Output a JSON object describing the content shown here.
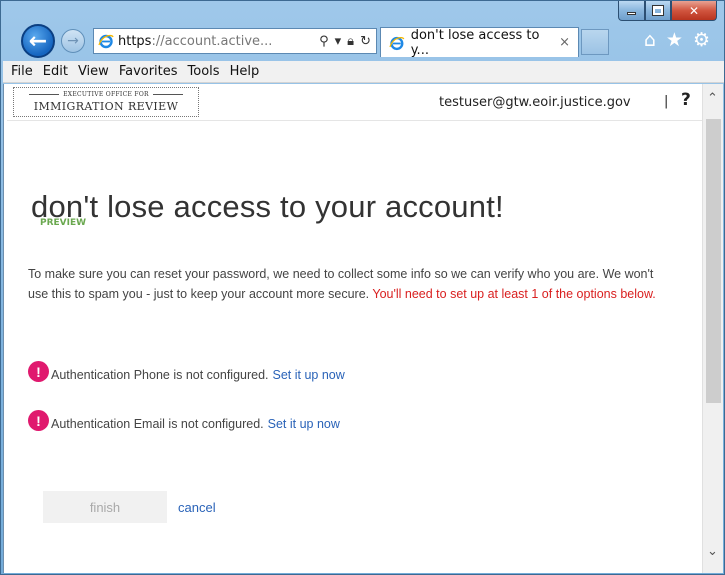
{
  "browser": {
    "address_https": "https",
    "address_rest": "://account.active...",
    "tab_title": "don't lose access to y...",
    "tab_close": "×"
  },
  "menu": [
    "File",
    "Edit",
    "View",
    "Favorites",
    "Tools",
    "Help"
  ],
  "header": {
    "logo_small": "EXECUTIVE OFFICE FOR",
    "logo_main": "IMMIGRATION REVIEW",
    "user_email": "testuser@gtw.eoir.justice.gov",
    "separator": "|",
    "help": "?"
  },
  "content": {
    "title": "don't lose access to your account!",
    "preview_badge": "PREVIEW",
    "lead": "To make sure you can reset your password, we need to collect some info so we can verify who you are. We won't use this to spam you - just to keep your account more secure.",
    "lead_warning": "You'll need to set up at least 1 of the options below.",
    "phone_status": "Authentication Phone is not configured.",
    "phone_link": "Set it up now",
    "email_status": "Authentication Email is not configured.",
    "email_link": "Set it up now",
    "finish_label": "finish",
    "cancel_label": "cancel"
  },
  "colors": {
    "accent_link": "#2a63b8",
    "warning": "#d91f1f",
    "alert_icon": "#e0196e",
    "preview": "#6aa84f"
  }
}
